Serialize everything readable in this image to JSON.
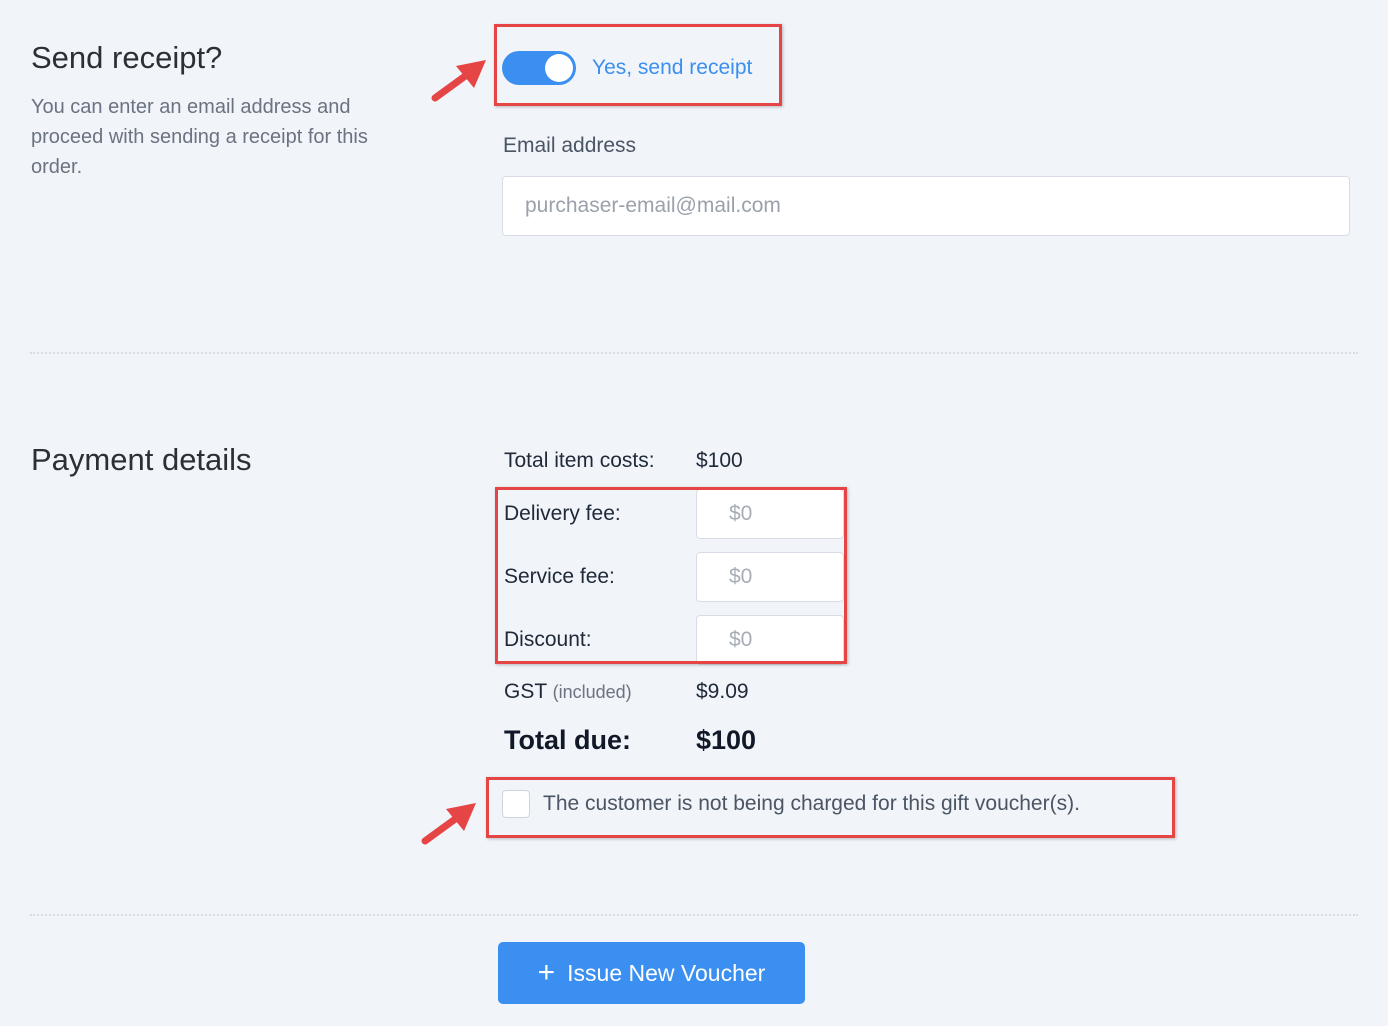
{
  "receipt": {
    "title": "Send receipt?",
    "description": "You can enter an email address and proceed with sending a receipt for this order.",
    "toggle_label": "Yes, send receipt",
    "toggle_on": true,
    "email_label": "Email address",
    "email_placeholder": "purchaser-email@mail.com",
    "email_value": ""
  },
  "payment": {
    "title": "Payment details",
    "total_item_costs_label": "Total item costs:",
    "total_item_costs_value": "$100",
    "delivery_fee_label": "Delivery fee:",
    "delivery_fee_placeholder": "$0",
    "service_fee_label": "Service fee:",
    "service_fee_placeholder": "$0",
    "discount_label": "Discount:",
    "discount_placeholder": "$0",
    "gst_label": "GST",
    "gst_note": "(included)",
    "gst_value": "$9.09",
    "total_due_label": "Total due:",
    "total_due_value": "$100",
    "no_charge_label": "The customer is not being charged for this gift voucher(s).",
    "no_charge_checked": false
  },
  "actions": {
    "issue_button_label": "Issue New Voucher"
  },
  "colors": {
    "accent": "#3b8ff0",
    "annotation": "#e64545",
    "background": "#f1f4f9"
  }
}
